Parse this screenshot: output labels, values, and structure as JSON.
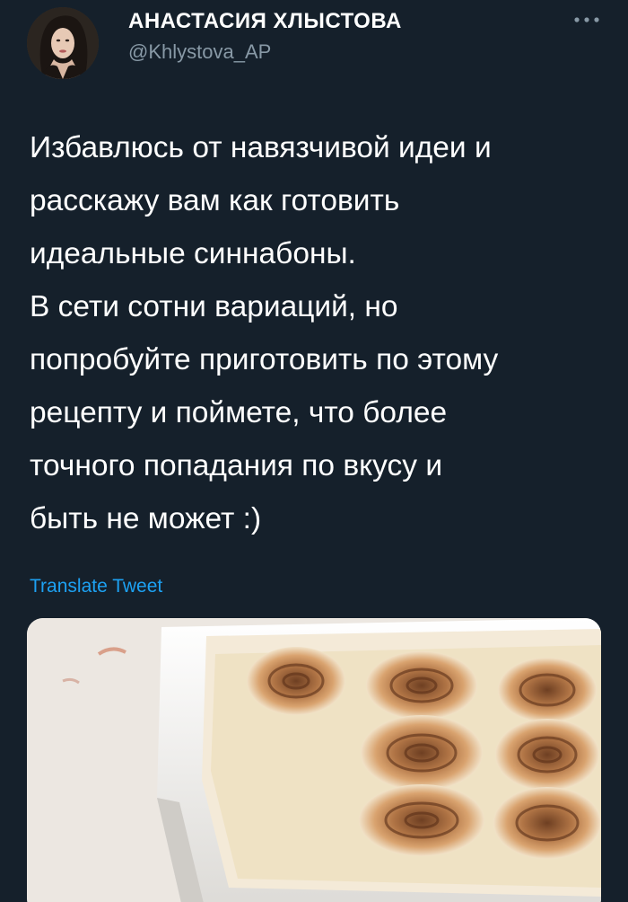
{
  "author": {
    "display_name": "АНАСТАСИЯ ХЛЫСТОВА",
    "handle": "@Khlystova_AP",
    "avatar_icon": "profile-photo"
  },
  "menu": {
    "icon": "more-dots-icon"
  },
  "tweet": {
    "text": "Избавлюсь от навязчивой идеи и\nрасскажу вам как готовить\nидеальные синнабоны.\nВ сети сотни вариаций, но\nпопробуйте приготовить по этому\nрецепту и поймете, что более\nточного попадания по вкусу и\nбыть не может :)",
    "translate_label": "Translate Tweet",
    "image": "cinnamon-rolls-photo"
  },
  "colors": {
    "background": "#15202b",
    "text": "#ffffff",
    "secondary_text": "#8899a6",
    "link": "#1da1f2"
  }
}
